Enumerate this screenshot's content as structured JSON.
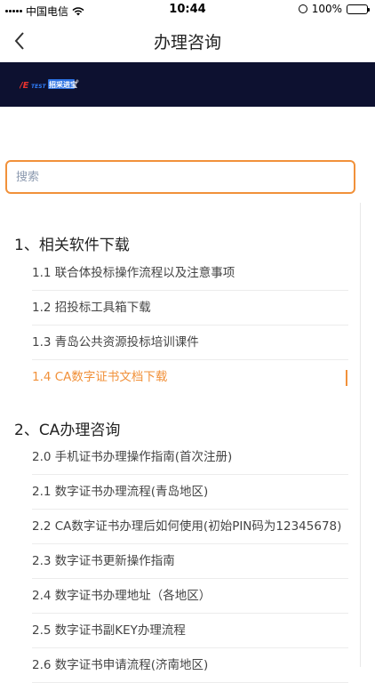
{
  "status_bar": {
    "carrier": "中国电信",
    "time": "10:44",
    "battery": "100%",
    "battery_level": 1.0
  },
  "nav": {
    "title": "办理咨询"
  },
  "banner": {
    "logo_text": "ITEST 招采进宝"
  },
  "search": {
    "placeholder": "搜索",
    "value": ""
  },
  "sections": [
    {
      "title": "1、相关软件下载",
      "items": [
        {
          "label": "1.1 联合体投标操作流程以及注意事项"
        },
        {
          "label": "1.2 招投标工具箱下载"
        },
        {
          "label": "1.3 青岛公共资源投标培训课件"
        },
        {
          "label": "1.4 CA数字证书文档下载"
        }
      ]
    },
    {
      "title": "2、CA办理咨询",
      "items": [
        {
          "label": "2.0 手机证书办理操作指南(首次注册)"
        },
        {
          "label": "2.1 数字证书办理流程(青岛地区)"
        },
        {
          "label": "2.2 CA数字证书办理后如何使用(初始PIN码为12345678)"
        },
        {
          "label": "2.3 数字证书更新操作指南"
        },
        {
          "label": "2.4 数字证书办理地址（各地区）"
        },
        {
          "label": "2.5 数字证书副KEY办理流程"
        },
        {
          "label": "2.6 数字证书申请流程(济南地区)"
        }
      ]
    }
  ],
  "active_item": "1.4",
  "colors": {
    "accent": "#f1913a",
    "banner_bg": "#0d1130",
    "logo_red": "#e8322e",
    "logo_blue": "#2f7cf6"
  }
}
